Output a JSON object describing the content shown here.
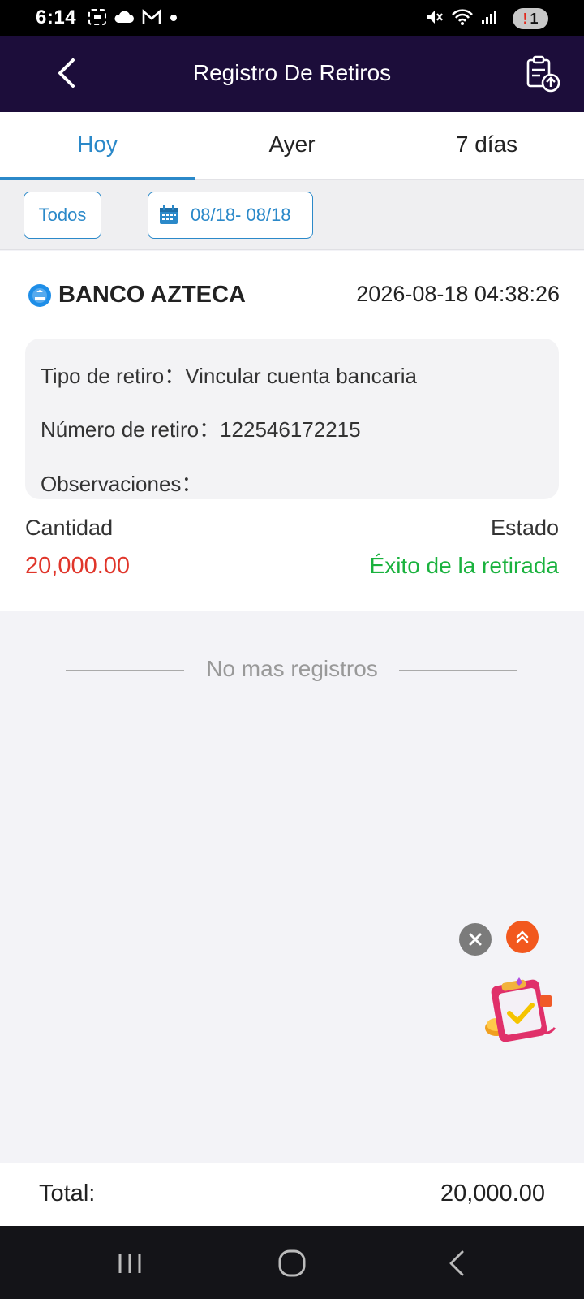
{
  "status_bar": {
    "time": "6:14",
    "notification_count": "1"
  },
  "header": {
    "title": "Registro De Retiros"
  },
  "tabs": [
    {
      "label": "Hoy",
      "active": true
    },
    {
      "label": "Ayer",
      "active": false
    },
    {
      "label": "7 días",
      "active": false
    }
  ],
  "filters": {
    "all_label": "Todos",
    "date_range": "08/18- 08/18"
  },
  "record": {
    "bank": "BANCO AZTECA",
    "datetime": "2026-08-18 04:38:26",
    "type_label": "Tipo de retiro：",
    "type_value": "Vincular cuenta bancaria",
    "number_label": "Número de retiro：",
    "number_value": "122546172215",
    "notes_label": "Observaciones：",
    "notes_value": "",
    "amount_label": "Cantidad",
    "amount_value": "20,000.00",
    "status_label": "Estado",
    "status_value": "Éxito de la retirada"
  },
  "no_more": "No mas registros",
  "footer": {
    "total_label": "Total:",
    "total_value": "20,000.00"
  },
  "colors": {
    "header_bg": "#1c0d3a",
    "accent": "#2b89c9",
    "amount": "#e0352a",
    "success": "#1ab23e"
  }
}
